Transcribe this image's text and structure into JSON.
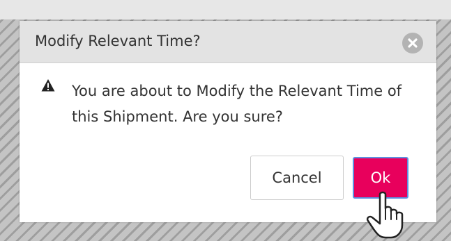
{
  "dialog": {
    "title": "Modify Relevant Time?",
    "message": "You are about to Modify the Relevant Time of this Shipment. Are you sure?",
    "cancel_label": "Cancel",
    "ok_label": "Ok"
  },
  "icons": {
    "close": "close-circle-icon",
    "warning": "warning-triangle-icon",
    "cursor": "hand-pointer-cursor-icon"
  },
  "colors": {
    "header_bg": "#e3e3e3",
    "ok_button_bg": "#e8005c",
    "ok_button_border": "#5c8fe0",
    "close_button_bg": "#b3b3b3",
    "text": "#333333"
  }
}
